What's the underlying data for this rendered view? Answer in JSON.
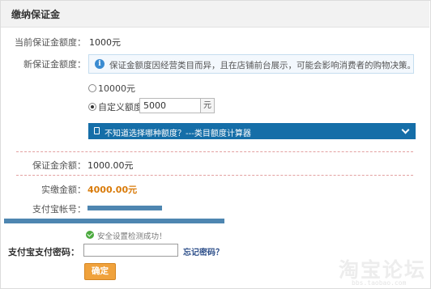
{
  "header": {
    "title": "缴纳保证金"
  },
  "current_deposit": {
    "label": "当前保证金额度：",
    "value": "1000元"
  },
  "new_deposit": {
    "label": "新保证金额度：",
    "notice": "保证金额度因经营类目而异，且在店铺前台展示，可能会影响消费者的购物决策。",
    "options": [
      {
        "label": "10000元",
        "checked": false
      },
      {
        "label": "自定义额度",
        "checked": true
      }
    ],
    "custom_amount": "5000",
    "unit": "元",
    "calculator_bar": "不知道选择哪种额度？---类目额度计算器"
  },
  "balance": {
    "label": "保证金余额：",
    "value": "1000.00元"
  },
  "actual_payment": {
    "label": "实缴金额：",
    "value": "4000.00元",
    "color": "#d97b0a"
  },
  "alipay_account": {
    "label": "支付宝帐号："
  },
  "security_check": {
    "text": "安全设置检测成功！",
    "icon": "check-circle-icon"
  },
  "alipay_password": {
    "label": "支付宝支付密码：",
    "value": "",
    "forgot_link": "忘记密码？"
  },
  "confirm_button": "确定",
  "watermark": {
    "text": "淘宝论坛",
    "url": "bbs.taobao.com"
  }
}
